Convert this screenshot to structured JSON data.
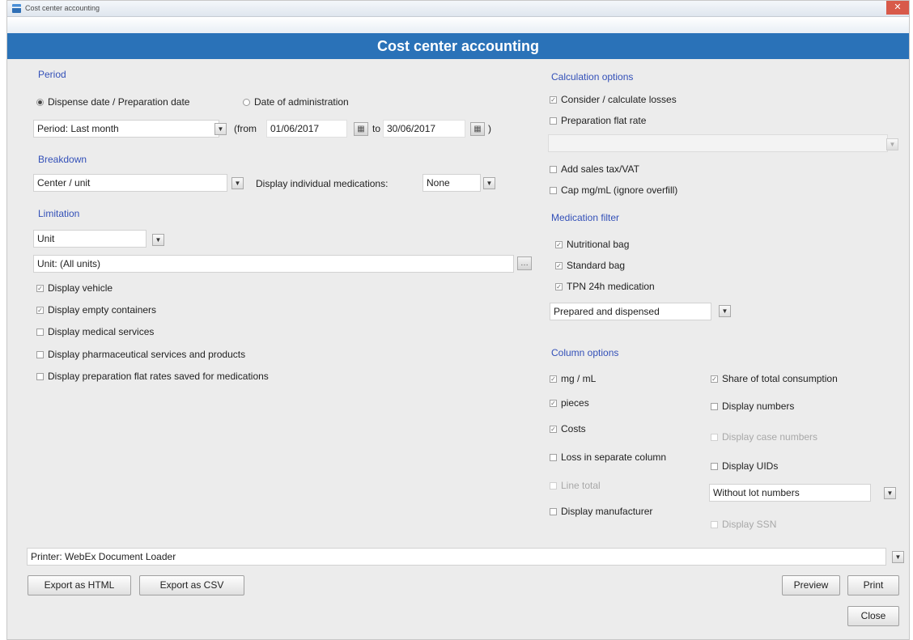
{
  "window": {
    "title": "Cost center accounting"
  },
  "header": {
    "title": "Cost center accounting"
  },
  "period": {
    "section": "Period",
    "radio_dispense": "Dispense date / Preparation date",
    "radio_admin": "Date of administration",
    "period_value": "Period: Last month",
    "from_prefix": "(from",
    "from_date": "01/06/2017",
    "to_prefix": "to",
    "to_date": "30/06/2017",
    "close_paren": ")"
  },
  "breakdown": {
    "section": "Breakdown",
    "value": "Center / unit",
    "meds_label": "Display individual medications:",
    "meds_value": "None"
  },
  "limitation": {
    "section": "Limitation",
    "type_value": "Unit",
    "unit_value": "Unit: (All units)",
    "options": [
      {
        "label": "Display vehicle",
        "checked": true
      },
      {
        "label": "Display empty containers",
        "checked": true
      },
      {
        "label": "Display medical services",
        "checked": false
      },
      {
        "label": "Display pharmaceutical services and products",
        "checked": false
      },
      {
        "label": "Display preparation flat rates saved for medications",
        "checked": false
      }
    ]
  },
  "calculation": {
    "section": "Calculation options",
    "consider_losses": "Consider / calculate losses",
    "flat_rate": "Preparation flat rate",
    "add_vat": "Add sales tax/VAT",
    "cap": "Cap mg/mL (ignore overfill)"
  },
  "medication_filter": {
    "section": "Medication filter",
    "options": [
      "Nutritional bag",
      "Standard bag",
      "TPN 24h medication"
    ],
    "status_value": "Prepared and dispensed"
  },
  "columns": {
    "section": "Column options",
    "left": [
      {
        "label": "mg / mL",
        "checked": true,
        "disabled": false
      },
      {
        "label": "pieces",
        "checked": true,
        "disabled": false
      },
      {
        "label": "Costs",
        "checked": true,
        "disabled": false
      },
      {
        "label": "Loss in separate column",
        "checked": false,
        "disabled": false
      },
      {
        "label": "Line total",
        "checked": false,
        "disabled": true
      },
      {
        "label": "Display manufacturer",
        "checked": false,
        "disabled": false
      }
    ],
    "share": "Share of total consumption",
    "display_numbers": "Display numbers",
    "display_case_numbers": "Display case numbers",
    "display_uids": "Display UIDs",
    "lot_value": "Without lot numbers",
    "display_ssn": "Display SSN"
  },
  "printer": {
    "value": "Printer: WebEx Document Loader"
  },
  "buttons": {
    "export_html": "Export as HTML",
    "export_csv": "Export as CSV",
    "preview": "Preview",
    "print": "Print",
    "close": "Close"
  }
}
